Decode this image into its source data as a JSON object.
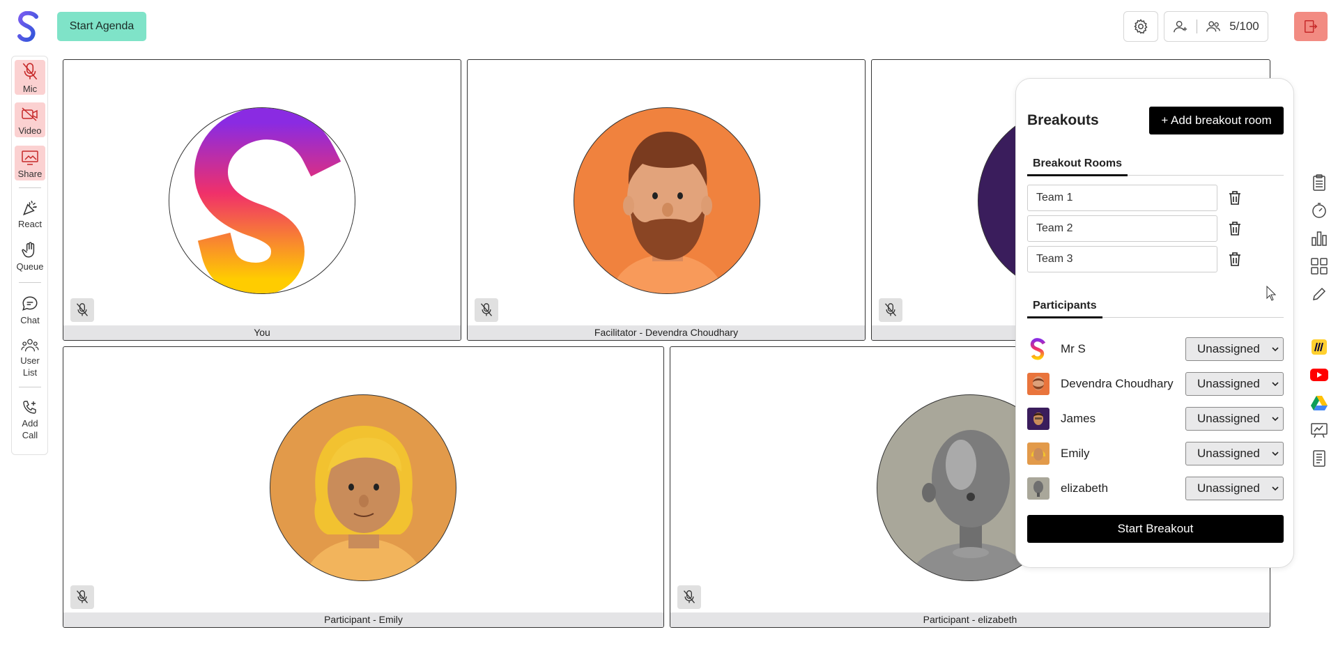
{
  "header": {
    "start_agenda_label": "Start Agenda",
    "participant_count": "5/100"
  },
  "toolbar": {
    "items": [
      {
        "label": "Mic",
        "icon": "mic-off-icon",
        "state": "off"
      },
      {
        "label": "Video",
        "icon": "video-off-icon",
        "state": "off"
      },
      {
        "label": "Share",
        "icon": "screen-share-icon",
        "state": "off"
      },
      {
        "label": "React",
        "icon": "party-popper-icon"
      },
      {
        "label": "Queue",
        "icon": "raised-hand-icon"
      },
      {
        "label": "Chat",
        "icon": "chat-bubble-icon"
      },
      {
        "label": "User List",
        "icon": "users-icon"
      },
      {
        "label": "Add Call",
        "icon": "phone-plus-icon"
      }
    ]
  },
  "tiles": [
    {
      "name": "You",
      "avatar": "logo"
    },
    {
      "name": "Facilitator - Devendra Choudhary",
      "avatar": "bearded-man"
    },
    {
      "name": "",
      "avatar": "purple"
    },
    {
      "name": "Participant - Emily",
      "avatar": "blonde-woman"
    },
    {
      "name": "Participant - elizabeth",
      "avatar": "metal-bust"
    }
  ],
  "breakouts": {
    "title": "Breakouts",
    "add_room_label": "+ Add breakout room",
    "rooms_tab": "Breakout Rooms",
    "rooms": [
      "Team 1",
      "Team 2",
      "Team 3"
    ],
    "participants_tab": "Participants",
    "participants": [
      {
        "name": "Mr S",
        "assignment": "Unassigned",
        "avatar_color": "#ffffff"
      },
      {
        "name": "Devendra Choudhary",
        "assignment": "Unassigned",
        "avatar_color": "#e9743c"
      },
      {
        "name": "James",
        "assignment": "Unassigned",
        "avatar_color": "#3a1d5c"
      },
      {
        "name": "Emily",
        "assignment": "Unassigned",
        "avatar_color": "#e29a4a"
      },
      {
        "name": "elizabeth",
        "assignment": "Unassigned",
        "avatar_color": "#a9a79a"
      }
    ],
    "start_label": "Start Breakout"
  },
  "right_apps": [
    "clipboard-icon",
    "timer-icon",
    "bar-chart-icon",
    "grid-apps-icon",
    "pencil-icon",
    "miro-icon",
    "youtube-icon",
    "google-drive-icon",
    "whiteboard-icon",
    "document-icon"
  ],
  "colors": {
    "accent_green": "#7fe3c8",
    "leave_red": "#f28b82",
    "toolbar_red": "#fbd1d1"
  }
}
